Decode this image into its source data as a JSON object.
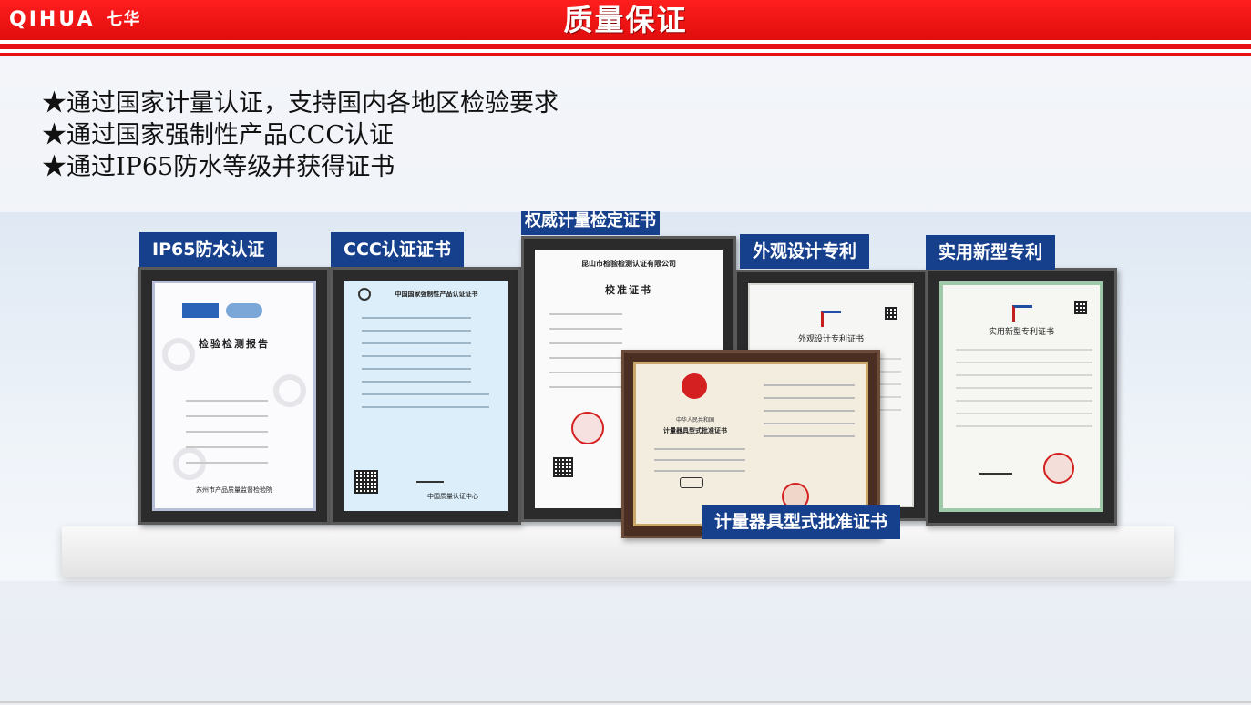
{
  "header": {
    "logo_en": "QIHUA",
    "logo_cn": "七华",
    "title": "质量保证"
  },
  "bullets": [
    "★通过国家计量认证，支持国内各地区检验要求",
    "★通过国家强制性产品CCC认证",
    "★通过IP65防水等级并获得证书"
  ],
  "certificates": [
    {
      "label": "IP65防水认证",
      "paper_title": "检验检测报告",
      "footer": "苏州市产品质量监督检验院"
    },
    {
      "label": "CCC认证证书",
      "paper_title": "中国国家强制性产品认证证书",
      "footer": "中国质量认证中心"
    },
    {
      "label": "权威计量检定证书",
      "paper_title": "校准证书",
      "header_text": "昆山市检验检测认证有限公司"
    },
    {
      "label": "外观设计专利",
      "paper_title": "外观设计专利证书"
    },
    {
      "label": "实用新型专利",
      "paper_title": "实用新型专利证书"
    },
    {
      "label": "计量器具型式批准证书",
      "paper_title": "计量器具型式批准证书",
      "header_text": "中华人民共和国"
    }
  ],
  "colors": {
    "header_red": "#e81010",
    "label_blue": "#163f8c",
    "seal_red": "#d42020"
  }
}
